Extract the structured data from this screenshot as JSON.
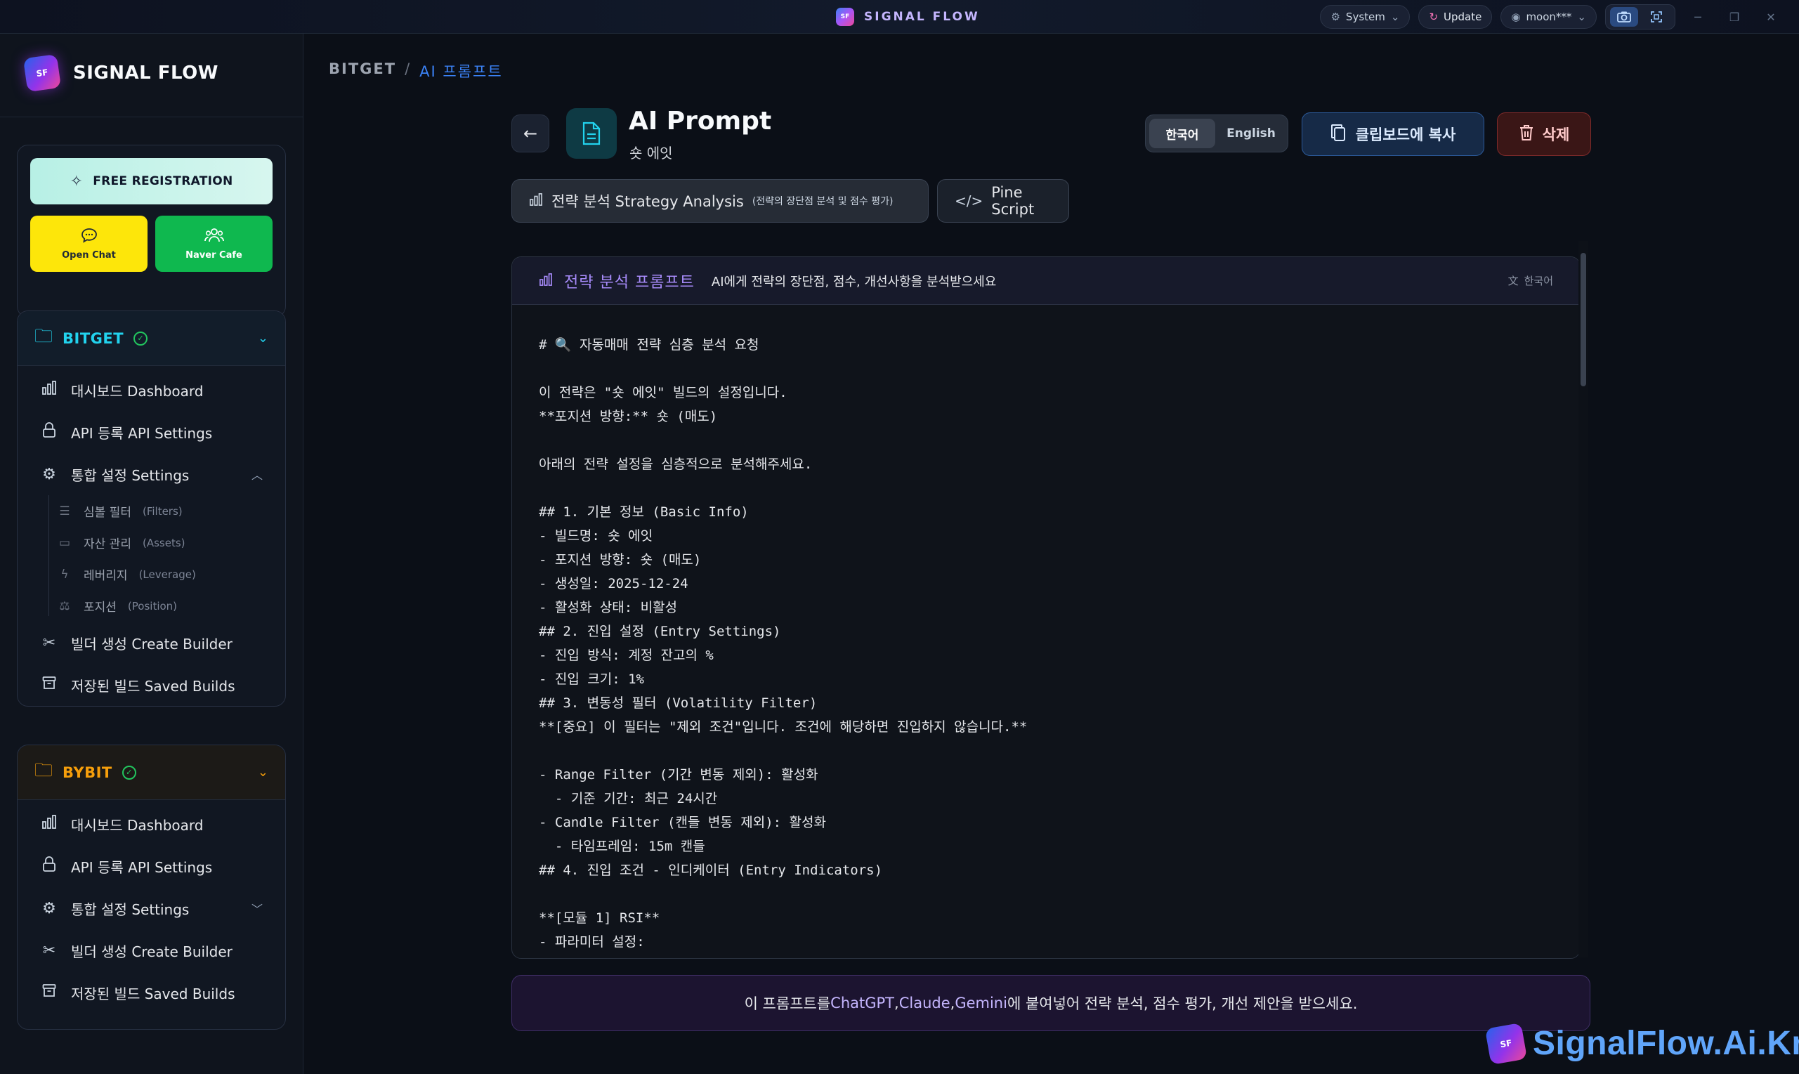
{
  "titlebar": {
    "title": "SIGNAL FLOW",
    "logo_text": "SF",
    "system_label": "System",
    "update_label": "Update",
    "user_label": "moon***",
    "icons": [
      "gear-icon",
      "refresh-icon",
      "user-circle-icon",
      "camera-icon",
      "crop-icon",
      "minimize-icon",
      "maximize-icon",
      "close-icon"
    ]
  },
  "sidebar": {
    "brand": "SIGNAL FLOW",
    "logo_text": "SF",
    "promo": {
      "free_registration": "FREE REGISTRATION",
      "open_chat": "Open Chat",
      "naver_cafe": "Naver Cafe"
    },
    "exchanges": [
      {
        "name": "BITGET",
        "color": "#22d3ee",
        "items": [
          {
            "label": "대시보드 Dashboard"
          },
          {
            "label": "API 등록 API Settings"
          },
          {
            "label": "통합 설정 Settings"
          },
          {
            "label": "빌더 생성 Create Builder"
          },
          {
            "label": "저장된 빌드 Saved Builds"
          }
        ],
        "sub_items": [
          {
            "ko": "심볼 필터",
            "en": "(Filters)"
          },
          {
            "ko": "자산 관리",
            "en": "(Assets)"
          },
          {
            "ko": "레버리지",
            "en": "(Leverage)"
          },
          {
            "ko": "포지션",
            "en": "(Position)"
          }
        ]
      },
      {
        "name": "BYBIT",
        "color": "#f59e0b",
        "items": [
          {
            "label": "대시보드 Dashboard"
          },
          {
            "label": "API 등록 API Settings"
          },
          {
            "label": "통합 설정 Settings"
          },
          {
            "label": "빌더 생성 Create Builder"
          },
          {
            "label": "저장된 빌드 Saved Builds"
          }
        ]
      }
    ]
  },
  "breadcrumb": {
    "root": "BITGET",
    "separator": "/",
    "current": "AI 프롬프트"
  },
  "header": {
    "title": "AI Prompt",
    "subtitle": "숏 에잇",
    "lang_ko": "한국어",
    "lang_en": "English",
    "copy_label": "클립보드에 복사",
    "delete_label": "삭제"
  },
  "tabs": {
    "strategy_label": "전략 분석 Strategy Analysis",
    "strategy_note": "(전략의 장단점 분석 및 점수 평가)",
    "pine_label": "Pine Script"
  },
  "panel": {
    "title": "전략 분석 프롬프트",
    "description": "AI에게 전략의 장단점, 점수, 개선사항을 분석받으세요",
    "lang": "한국어",
    "lines": [
      "# 🔍 자동매매 전략 심층 분석 요청",
      "",
      "이 전략은 \"숏 에잇\" 빌드의 설정입니다.",
      "**포지션 방향:** 숏 (매도)",
      "",
      "아래의 전략 설정을 심층적으로 분석해주세요.",
      "",
      "## 1. 기본 정보 (Basic Info)",
      "- 빌드명: 숏 에잇",
      "- 포지션 방향: 숏 (매도)",
      "- 생성일: 2025-12-24",
      "- 활성화 상태: 비활성",
      "## 2. 진입 설정 (Entry Settings)",
      "- 진입 방식: 계정 잔고의 %",
      "- 진입 크기: 1%",
      "## 3. 변동성 필터 (Volatility Filter)",
      "**[중요] 이 필터는 \"제외 조건\"입니다. 조건에 해당하면 진입하지 않습니다.**",
      "",
      "- Range Filter (기간 변동 제외): 활성화",
      "  - 기준 기간: 최근 24시간",
      "- Candle Filter (캔들 변동 제외): 활성화",
      "  - 타임프레임: 15m 캔들",
      "## 4. 진입 조건 - 인디케이터 (Entry Indicators)",
      "",
      "**[모듈 1] RSI**",
      "- 파라미터 설정:"
    ]
  },
  "footer_note": {
    "prefix": "이 프롬프트를 ",
    "chatgpt": "ChatGPT",
    "sep1": ", ",
    "claude": "Claude",
    "sep2": ", ",
    "gemini": "Gemini",
    "suffix": "에 붙여넣어 전략 분석, 점수 평가, 개선 제안을 받으세요."
  },
  "watermark": {
    "text": "SignalFlow.Ai.Kr",
    "logo_text": "SF"
  }
}
